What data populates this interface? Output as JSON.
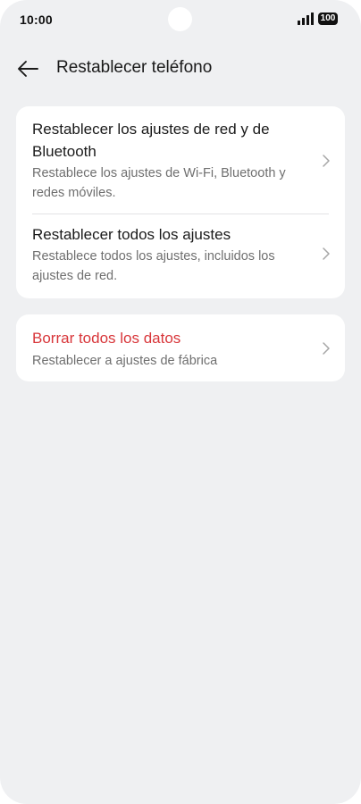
{
  "status_bar": {
    "time": "10:00",
    "battery": "100"
  },
  "header": {
    "title": "Restablecer teléfono"
  },
  "groups": [
    {
      "items": [
        {
          "title": "Restablecer los ajustes de red y de Bluetooth",
          "subtitle": "Restablece los ajustes de Wi-Fi, Bluetooth y redes móviles."
        },
        {
          "title": "Restablecer todos los ajustes",
          "subtitle": "Restablece todos los ajustes, incluidos los ajustes de red."
        }
      ]
    },
    {
      "items": [
        {
          "title": "Borrar todos los datos",
          "subtitle": "Restablecer a ajustes de fábrica"
        }
      ]
    }
  ],
  "colors": {
    "background": "#eff0f2",
    "card": "#ffffff",
    "danger": "#d8363a",
    "secondary_text": "#6f6f6f"
  },
  "icons": {
    "back": "arrow-left-icon",
    "chevron": "chevron-right-icon",
    "signal": "signal-icon",
    "battery": "battery-icon"
  }
}
